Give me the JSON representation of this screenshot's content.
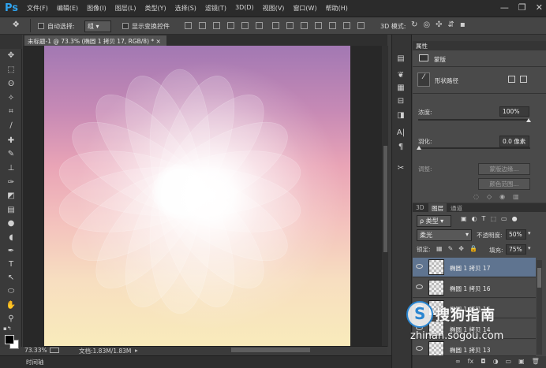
{
  "app": {
    "logo": "Ps"
  },
  "menu": [
    "文件(F)",
    "编辑(E)",
    "图像(I)",
    "图层(L)",
    "类型(Y)",
    "选择(S)",
    "滤镜(T)",
    "3D(D)",
    "视图(V)",
    "窗口(W)",
    "帮助(H)"
  ],
  "window_controls": {
    "minimize": "—",
    "restore": "❐",
    "close": "✕"
  },
  "options": {
    "auto_select_label": "自动选择:",
    "auto_select_value": "组",
    "show_transform_label": "显示变换控件",
    "mode_3d_label": "3D 模式:"
  },
  "document": {
    "tab_title": "未标题-1 @ 73.3% (椭圆 1 拷贝 17, RGB/8) *",
    "tab_close": "×",
    "zoom": "73.33%",
    "doc_size": "文档:1.83M/1.83M",
    "timeline": "时间轴"
  },
  "properties": {
    "panel_title": "属性",
    "mask_label": "蒙版",
    "shape_path": "形状路径",
    "density_label": "浓度:",
    "density_value": "100%",
    "feather_label": "羽化:",
    "feather_value": "0.0 像素",
    "refine_label": "调整:",
    "mask_edge_button": "蒙版边缘...",
    "color_range_button": "颜色范围..."
  },
  "layers": {
    "tab_3d": "3D",
    "tab_layers": "图层",
    "tab_channels": "通道",
    "filter_type": "ρ 类型",
    "blend_mode": "柔光",
    "opacity_label": "不透明度:",
    "opacity_value": "50%",
    "lock_label": "锁定:",
    "fill_label": "填充:",
    "fill_value": "75%",
    "items": [
      {
        "name": "椭圆 1 拷贝 17",
        "selected": true
      },
      {
        "name": "椭圆 1 拷贝 16",
        "selected": false
      },
      {
        "name": "椭圆 1 拷贝 15",
        "selected": false
      },
      {
        "name": "椭圆 1 拷贝 14",
        "selected": false
      },
      {
        "name": "椭圆 1 拷贝 13",
        "selected": false
      }
    ],
    "footer_icons": [
      "∞",
      "fx",
      "◘",
      "◑",
      "▭",
      "▣",
      "🗑"
    ]
  },
  "watermark": {
    "s": "S",
    "brand": "搜狗指南",
    "url": "zhinan.sogou.com"
  },
  "colors": {
    "accent_blue": "#2fa3ee",
    "selected_layer": "#5f7490",
    "canvas_top": "#a278b3",
    "canvas_bottom": "#f9ebbb"
  }
}
